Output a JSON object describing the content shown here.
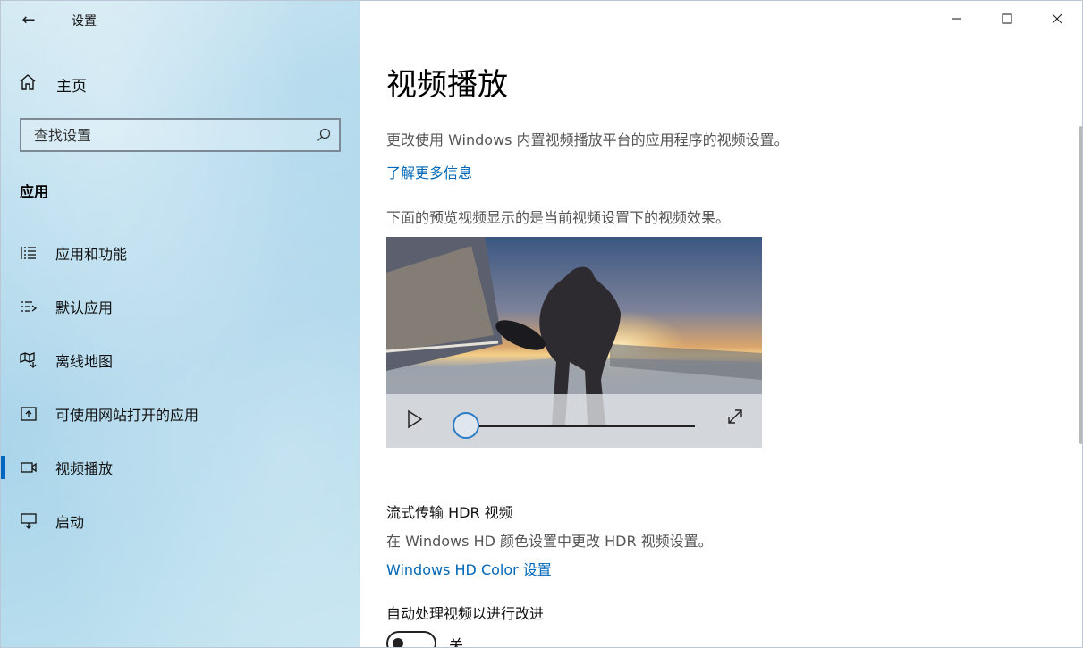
{
  "window": {
    "title": "设置",
    "controls": {
      "minimize": "—",
      "maximize": "☐",
      "close": "✕"
    }
  },
  "sidebar": {
    "back_icon": "←",
    "home": {
      "icon": "home-icon",
      "label": "主页"
    },
    "search": {
      "placeholder": "查找设置",
      "icon": "search-icon"
    },
    "section": "应用",
    "items": [
      {
        "label": "应用和功能",
        "icon": "apps-list-icon"
      },
      {
        "label": "默认应用",
        "icon": "default-apps-icon"
      },
      {
        "label": "离线地图",
        "icon": "map-download-icon"
      },
      {
        "label": "可使用网站打开的应用",
        "icon": "open-in-app-icon"
      },
      {
        "label": "视频播放",
        "icon": "video-icon",
        "active": true
      },
      {
        "label": "启动",
        "icon": "startup-icon"
      }
    ]
  },
  "main": {
    "title": "视频播放",
    "description": "更改使用 Windows 内置视频播放平台的应用程序的视频设置。",
    "learn_more": "了解更多信息",
    "preview_note": "下面的预览视频显示的是当前视频设置下的视频效果。",
    "preview": {
      "progress": 0
    },
    "hdr": {
      "title": "流式传输 HDR 视频",
      "description": "在 Windows HD 颜色设置中更改 HDR 视频设置。",
      "link": "Windows HD Color 设置"
    },
    "auto_process": {
      "title": "自动处理视频以进行改进",
      "state_label": "关",
      "state": false
    }
  }
}
